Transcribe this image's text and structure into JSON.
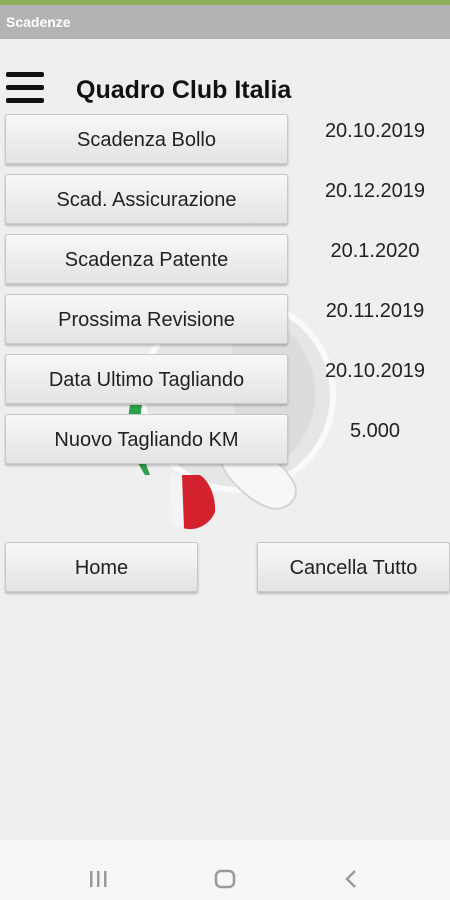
{
  "window": {
    "title": "Scadenze"
  },
  "header": {
    "app_title": "Quadro Club Italia"
  },
  "rows": [
    {
      "label": "Scadenza Bollo",
      "value": "20.10.2019"
    },
    {
      "label": "Scad. Assicurazione",
      "value": "20.12.2019"
    },
    {
      "label": "Scadenza Patente",
      "value": "20.1.2020"
    },
    {
      "label": "Prossima Revisione",
      "value": "20.11.2019"
    },
    {
      "label": "Data Ultimo Tagliando",
      "value": "20.10.2019"
    },
    {
      "label": "Nuovo Tagliando KM",
      "value": "5.000"
    }
  ],
  "actions": {
    "home_label": "Home",
    "clear_label": "Cancella Tutto"
  },
  "icons": {
    "menu": "hamburger-menu-icon",
    "logo": "quadrifoglio-logo",
    "nav_recent": "recent-apps-icon",
    "nav_home": "home-circle-icon",
    "nav_back": "back-chevron-icon"
  },
  "colors": {
    "status_bar": "#8fae5a",
    "title_bar": "#b3b3b3",
    "logo_green": "#2e9f4b",
    "logo_red": "#d3222e"
  }
}
